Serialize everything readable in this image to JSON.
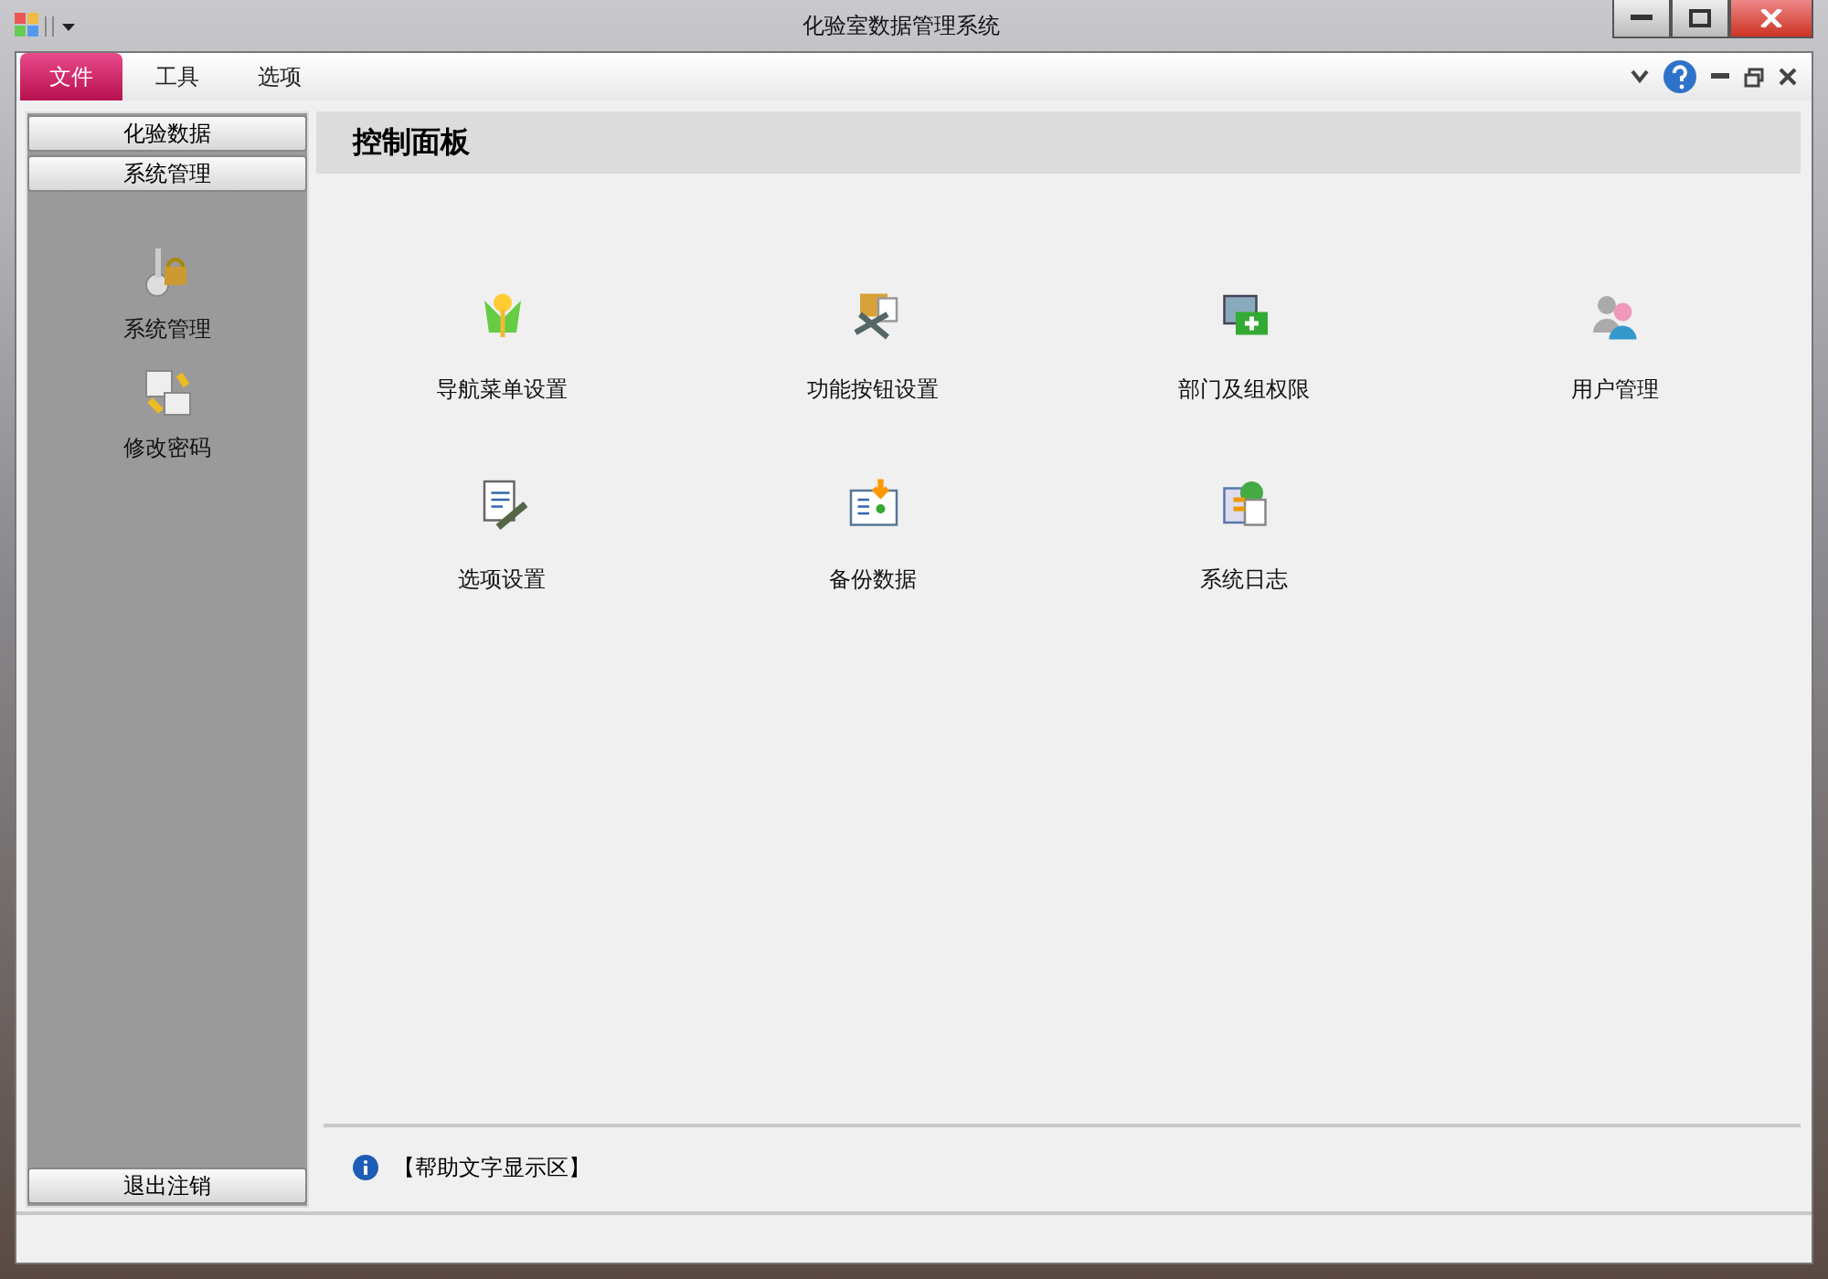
{
  "window": {
    "title": "化验室数据管理系统"
  },
  "menu": [
    {
      "label": "文件",
      "selected": true
    },
    {
      "label": "工具",
      "selected": false
    },
    {
      "label": "选项",
      "selected": false
    }
  ],
  "sidebar": {
    "groups": [
      {
        "label": "化验数据"
      },
      {
        "label": "系统管理"
      }
    ],
    "items": [
      {
        "label": "系统管理"
      },
      {
        "label": "修改密码"
      }
    ],
    "bottom_button": "退出注销"
  },
  "panel": {
    "title": "控制面板",
    "items": [
      {
        "label": "导航菜单设置"
      },
      {
        "label": "功能按钮设置"
      },
      {
        "label": "部门及组权限"
      },
      {
        "label": "用户管理"
      },
      {
        "label": "选项设置"
      },
      {
        "label": "备份数据"
      },
      {
        "label": "系统日志"
      }
    ]
  },
  "help_text": "【帮助文字显示区】"
}
